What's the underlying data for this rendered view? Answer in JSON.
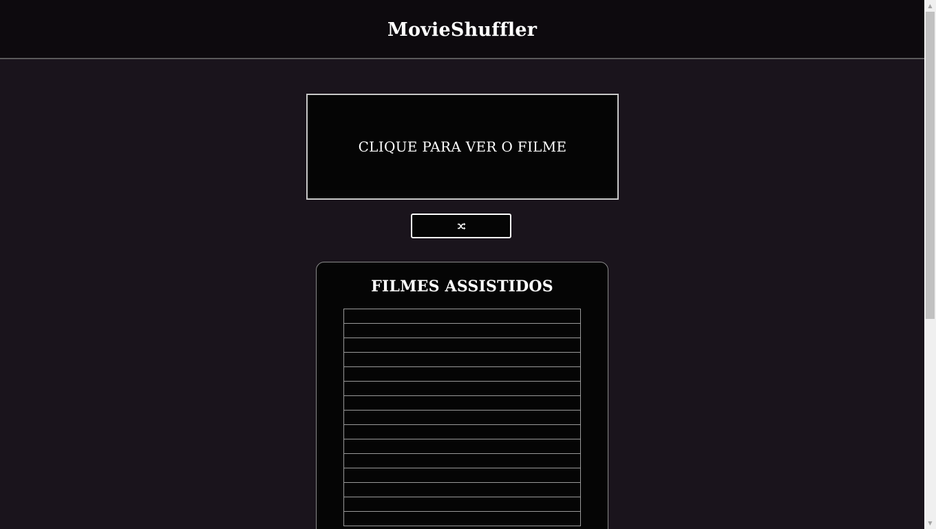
{
  "header": {
    "title": "MovieShuffler"
  },
  "movie_box": {
    "label": "CLIQUE PARA VER O FILME"
  },
  "shuffle_button": {
    "icon": "shuffle-icon"
  },
  "watched": {
    "title": "FILMES ASSISTIDOS",
    "items": [
      "",
      "",
      "",
      "",
      "",
      "",
      "",
      "",
      "",
      "",
      "",
      "",
      "",
      "",
      ""
    ]
  },
  "scrollbar": {
    "up_arrow": "▲",
    "down_arrow": "▼"
  }
}
